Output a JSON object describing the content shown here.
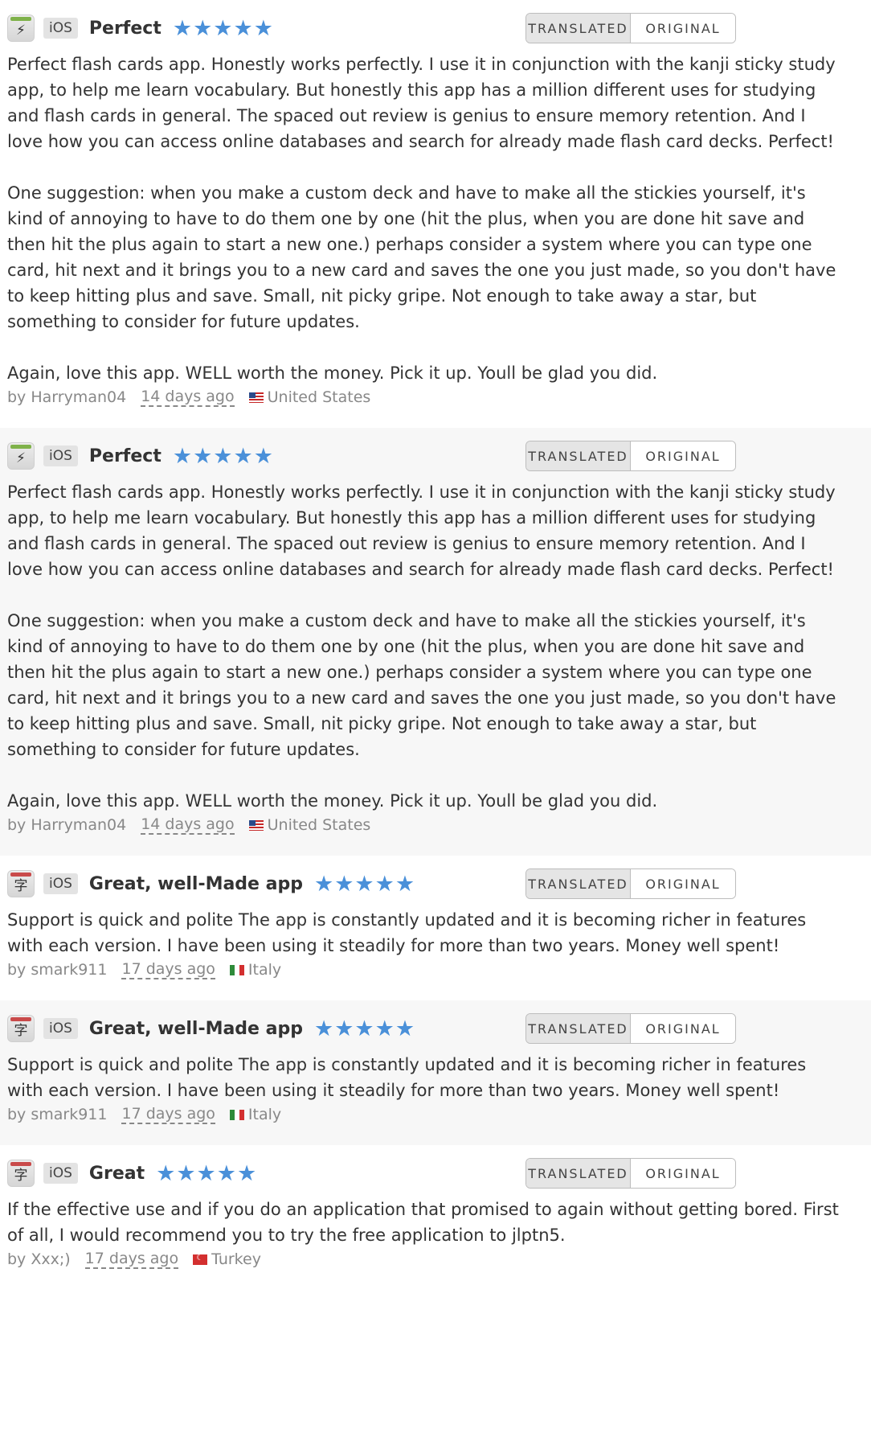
{
  "toggle": {
    "translated": "TRANSLATED",
    "original": "ORIGINAL"
  },
  "reviews": [
    {
      "platform": "iOS",
      "title": "Perfect",
      "stars": 5,
      "body": "Perfect flash cards app. Honestly works perfectly. I use it in conjunction with the kanji sticky study app, to help me learn vocabulary. But honestly this app has a million different uses for studying and flash cards in general. The spaced out review is genius to ensure memory retention. And I love how you can access online databases and search for already made flash card decks. Perfect!\n\nOne suggestion: when you make a custom deck and have to make all the stickies yourself, it's kind of annoying to have to do them one by one (hit the plus, when you are done hit save and then hit the plus again to start a new one.) perhaps consider a system where you can type one card, hit next and it brings you to a new card and saves the one you just made, so you don't have to keep hitting plus and save. Small, nit picky gripe. Not enough to take away a star, but something to consider for future updates.\n\nAgain, love this app. WELL worth the money. Pick it up. Youll be glad you did.",
      "author": "by Harryman04",
      "date": "14 days ago",
      "country": "United States",
      "icon": "flash-card-app-icon"
    },
    {
      "platform": "iOS",
      "title": "Perfect",
      "stars": 5,
      "body": "Perfect flash cards app. Honestly works perfectly. I use it in conjunction with the kanji sticky study app, to help me learn vocabulary. But honestly this app has a million different uses for studying and flash cards in general. The spaced out review is genius to ensure memory retention. And I love how you can access online databases and search for already made flash card decks. Perfect!\n\nOne suggestion: when you make a custom deck and have to make all the stickies yourself, it's kind of annoying to have to do them one by one (hit the plus, when you are done hit save and then hit the plus again to start a new one.) perhaps consider a system where you can type one card, hit next and it brings you to a new card and saves the one you just made, so you don't have to keep hitting plus and save. Small, nit picky gripe. Not enough to take away a star, but something to consider for future updates.\n\nAgain, love this app. WELL worth the money. Pick it up. Youll be glad you did.",
      "author": "by Harryman04",
      "date": "14 days ago",
      "country": "United States",
      "icon": "flash-card-app-icon"
    },
    {
      "platform": "iOS",
      "title": "Great, well-Made app",
      "stars": 5,
      "body": "Support is quick and polite The app is constantly updated and it is becoming richer in features with each version. I have been using it steadily for more than two years. Money well spent!",
      "author": "by smark911",
      "date": "17 days ago",
      "country": "Italy",
      "icon": "kanji-app-icon"
    },
    {
      "platform": "iOS",
      "title": "Great, well-Made app",
      "stars": 5,
      "body": "Support is quick and polite The app is constantly updated and it is becoming richer in features with each version. I have been using it steadily for more than two years. Money well spent!",
      "author": "by smark911",
      "date": "17 days ago",
      "country": "Italy",
      "icon": "kanji-app-icon"
    },
    {
      "platform": "iOS",
      "title": "Great",
      "stars": 5,
      "body": "If the effective use and if you do an application that promised to again without getting bored. First of all, I would recommend you to try the free application to jlptn5.",
      "author": "by Xxx;)",
      "date": "17 days ago",
      "country": "Turkey",
      "icon": "kanji-app-icon"
    }
  ]
}
